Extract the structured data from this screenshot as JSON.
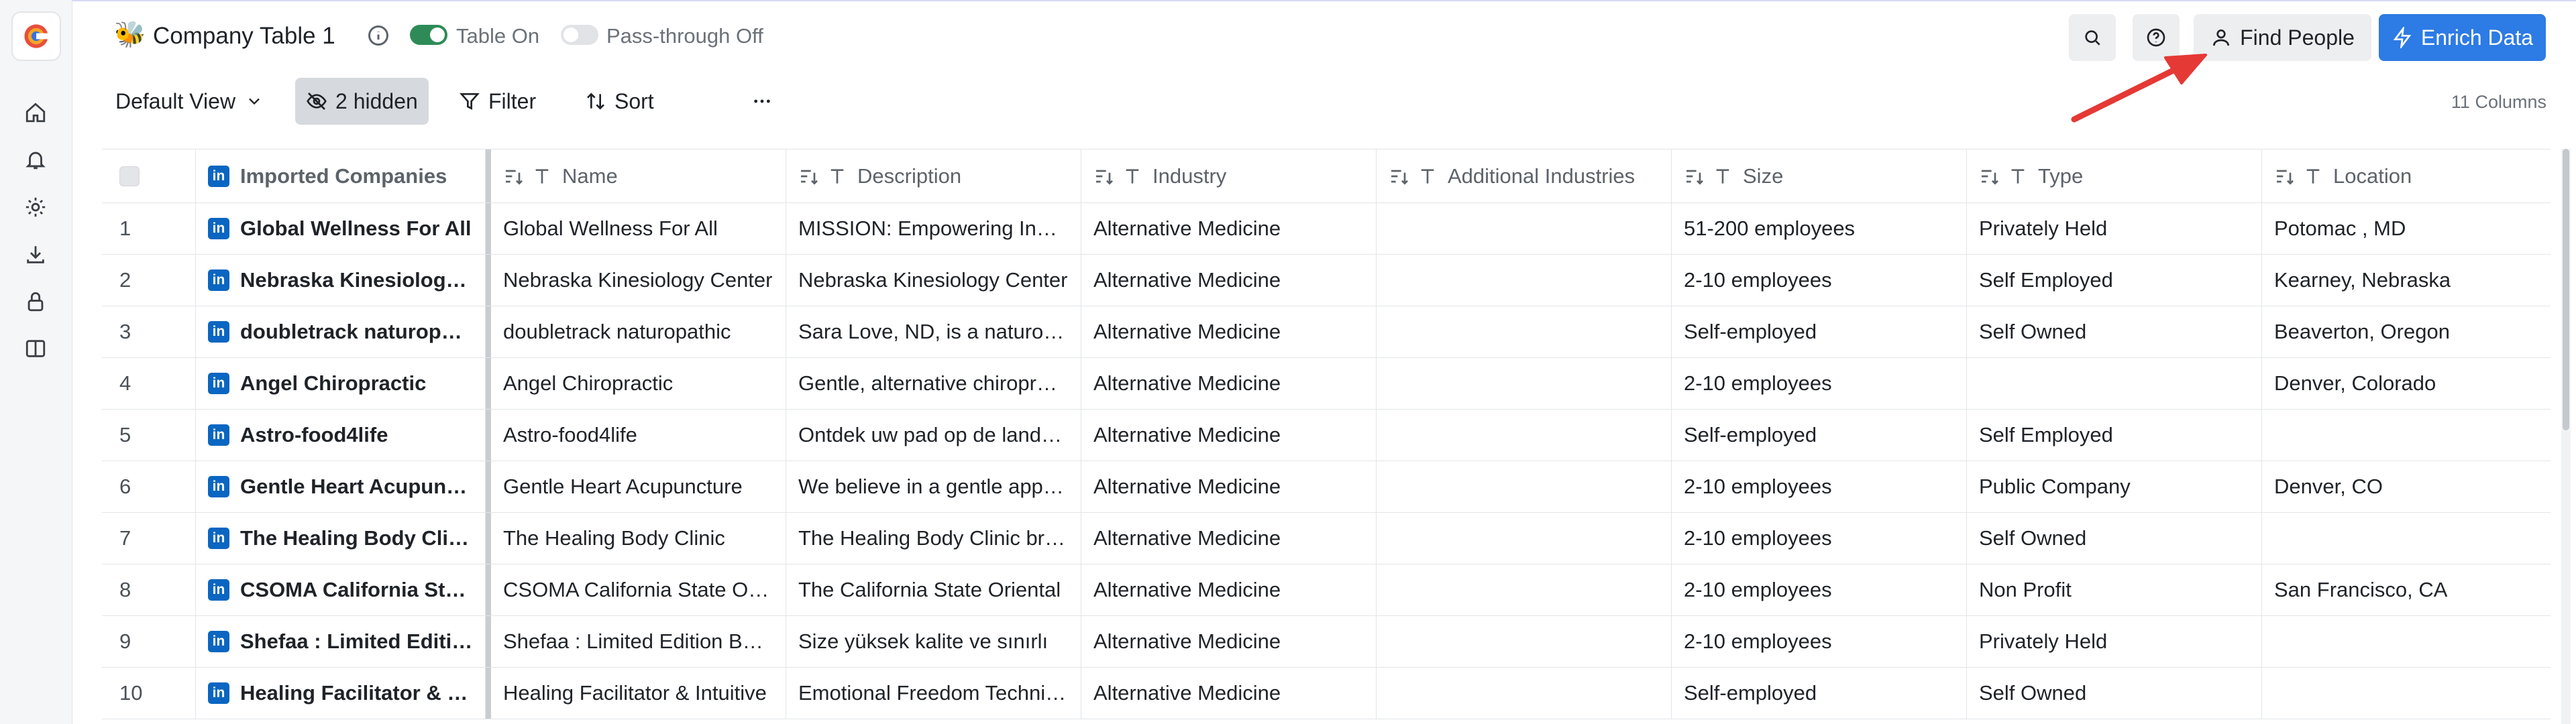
{
  "header": {
    "emoji": "🐝",
    "title": "Company Table 1",
    "table_toggle_label": "Table On",
    "passthrough_toggle_label": "Pass-through Off",
    "find_people_label": "Find People",
    "enrich_label": "Enrich Data"
  },
  "toolbar": {
    "view_label": "Default View",
    "hidden_label": "2 hidden",
    "filter_label": "Filter",
    "sort_label": "Sort",
    "column_count": "11 Columns"
  },
  "table": {
    "columns": {
      "imported": "Imported Companies",
      "name": "Name",
      "description": "Description",
      "industry": "Industry",
      "additional": "Additional Industries",
      "size": "Size",
      "type": "Type",
      "location": "Location"
    },
    "rows": [
      {
        "num": "1",
        "imported": "Global Wellness For All",
        "name": "Global Wellness For All",
        "description": "MISSION: Empowering Individuals",
        "industry": "Alternative Medicine",
        "additional": "",
        "size": "51-200 employees",
        "type": "Privately Held",
        "location": "Potomac , MD"
      },
      {
        "num": "2",
        "imported": "Nebraska Kinesiology Center",
        "name": "Nebraska Kinesiology Center",
        "description": "Nebraska Kinesiology Center",
        "industry": "Alternative Medicine",
        "additional": "",
        "size": "2-10 employees",
        "type": "Self Employed",
        "location": "Kearney, Nebraska"
      },
      {
        "num": "3",
        "imported": "doubletrack naturopathic",
        "name": "doubletrack naturopathic",
        "description": "Sara Love, ND, is a naturopathic",
        "industry": "Alternative Medicine",
        "additional": "",
        "size": "Self-employed",
        "type": "Self Owned",
        "location": "Beaverton, Oregon"
      },
      {
        "num": "4",
        "imported": "Angel Chiropractic",
        "name": "Angel Chiropractic",
        "description": "Gentle, alternative chiropractic",
        "industry": "Alternative Medicine",
        "additional": "",
        "size": "2-10 employees",
        "type": "",
        "location": "Denver, Colorado"
      },
      {
        "num": "5",
        "imported": "Astro-food4life",
        "name": "Astro-food4life",
        "description": "Ontdek uw pad op de landkaart",
        "industry": "Alternative Medicine",
        "additional": "",
        "size": "Self-employed",
        "type": "Self Employed",
        "location": ""
      },
      {
        "num": "6",
        "imported": "Gentle Heart Acupuncture",
        "name": "Gentle Heart Acupuncture",
        "description": "We believe in a gentle approach",
        "industry": "Alternative Medicine",
        "additional": "",
        "size": "2-10 employees",
        "type": "Public Company",
        "location": "Denver, CO"
      },
      {
        "num": "7",
        "imported": "The Healing Body Clinic",
        "name": "The Healing Body Clinic",
        "description": "The Healing Body Clinic brings",
        "industry": "Alternative Medicine",
        "additional": "",
        "size": "2-10 employees",
        "type": "Self Owned",
        "location": ""
      },
      {
        "num": "8",
        "imported": "CSOMA California State Oriental",
        "name": "CSOMA California State Oriental",
        "description": "The California State Oriental",
        "industry": "Alternative Medicine",
        "additional": "",
        "size": "2-10 employees",
        "type": "Non Profit",
        "location": "San Francisco, CA"
      },
      {
        "num": "9",
        "imported": "Shefaa : Limited Edition Beauty",
        "name": "Shefaa : Limited Edition Beauty",
        "description": "Size yüksek kalite ve sınırlı",
        "industry": "Alternative Medicine",
        "additional": "",
        "size": "2-10 employees",
        "type": "Privately Held",
        "location": ""
      },
      {
        "num": "10",
        "imported": "Healing Facilitator & Intuitive",
        "name": "Healing Facilitator & Intuitive",
        "description": "Emotional Freedom Technique",
        "industry": "Alternative Medicine",
        "additional": "",
        "size": "Self-employed",
        "type": "Self Owned",
        "location": ""
      }
    ]
  },
  "colors": {
    "accent": "#2d7be5",
    "toggle_on": "#2e8b57",
    "linkedin": "#0a66c2",
    "arrow": "#e53935"
  },
  "icons": {
    "linkedin": "linkedin-icon",
    "text_column": "text-type-icon",
    "sort_column": "column-sort-icon"
  }
}
